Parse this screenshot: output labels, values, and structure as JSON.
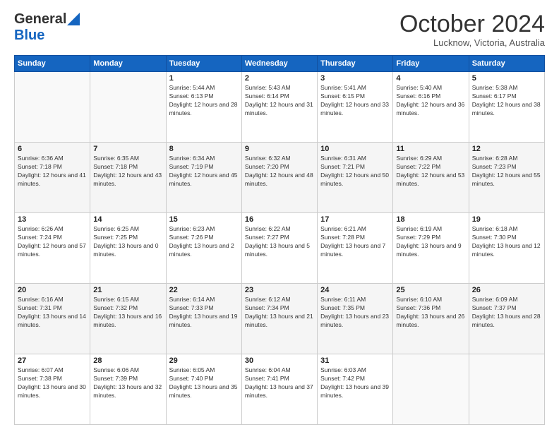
{
  "header": {
    "logo_general": "General",
    "logo_blue": "Blue",
    "month_title": "October 2024",
    "location": "Lucknow, Victoria, Australia"
  },
  "weekdays": [
    "Sunday",
    "Monday",
    "Tuesday",
    "Wednesday",
    "Thursday",
    "Friday",
    "Saturday"
  ],
  "weeks": [
    [
      {
        "day": "",
        "sunrise": "",
        "sunset": "",
        "daylight": ""
      },
      {
        "day": "",
        "sunrise": "",
        "sunset": "",
        "daylight": ""
      },
      {
        "day": "1",
        "sunrise": "Sunrise: 5:44 AM",
        "sunset": "Sunset: 6:13 PM",
        "daylight": "Daylight: 12 hours and 28 minutes."
      },
      {
        "day": "2",
        "sunrise": "Sunrise: 5:43 AM",
        "sunset": "Sunset: 6:14 PM",
        "daylight": "Daylight: 12 hours and 31 minutes."
      },
      {
        "day": "3",
        "sunrise": "Sunrise: 5:41 AM",
        "sunset": "Sunset: 6:15 PM",
        "daylight": "Daylight: 12 hours and 33 minutes."
      },
      {
        "day": "4",
        "sunrise": "Sunrise: 5:40 AM",
        "sunset": "Sunset: 6:16 PM",
        "daylight": "Daylight: 12 hours and 36 minutes."
      },
      {
        "day": "5",
        "sunrise": "Sunrise: 5:38 AM",
        "sunset": "Sunset: 6:17 PM",
        "daylight": "Daylight: 12 hours and 38 minutes."
      }
    ],
    [
      {
        "day": "6",
        "sunrise": "Sunrise: 6:36 AM",
        "sunset": "Sunset: 7:18 PM",
        "daylight": "Daylight: 12 hours and 41 minutes."
      },
      {
        "day": "7",
        "sunrise": "Sunrise: 6:35 AM",
        "sunset": "Sunset: 7:18 PM",
        "daylight": "Daylight: 12 hours and 43 minutes."
      },
      {
        "day": "8",
        "sunrise": "Sunrise: 6:34 AM",
        "sunset": "Sunset: 7:19 PM",
        "daylight": "Daylight: 12 hours and 45 minutes."
      },
      {
        "day": "9",
        "sunrise": "Sunrise: 6:32 AM",
        "sunset": "Sunset: 7:20 PM",
        "daylight": "Daylight: 12 hours and 48 minutes."
      },
      {
        "day": "10",
        "sunrise": "Sunrise: 6:31 AM",
        "sunset": "Sunset: 7:21 PM",
        "daylight": "Daylight: 12 hours and 50 minutes."
      },
      {
        "day": "11",
        "sunrise": "Sunrise: 6:29 AM",
        "sunset": "Sunset: 7:22 PM",
        "daylight": "Daylight: 12 hours and 53 minutes."
      },
      {
        "day": "12",
        "sunrise": "Sunrise: 6:28 AM",
        "sunset": "Sunset: 7:23 PM",
        "daylight": "Daylight: 12 hours and 55 minutes."
      }
    ],
    [
      {
        "day": "13",
        "sunrise": "Sunrise: 6:26 AM",
        "sunset": "Sunset: 7:24 PM",
        "daylight": "Daylight: 12 hours and 57 minutes."
      },
      {
        "day": "14",
        "sunrise": "Sunrise: 6:25 AM",
        "sunset": "Sunset: 7:25 PM",
        "daylight": "Daylight: 13 hours and 0 minutes."
      },
      {
        "day": "15",
        "sunrise": "Sunrise: 6:23 AM",
        "sunset": "Sunset: 7:26 PM",
        "daylight": "Daylight: 13 hours and 2 minutes."
      },
      {
        "day": "16",
        "sunrise": "Sunrise: 6:22 AM",
        "sunset": "Sunset: 7:27 PM",
        "daylight": "Daylight: 13 hours and 5 minutes."
      },
      {
        "day": "17",
        "sunrise": "Sunrise: 6:21 AM",
        "sunset": "Sunset: 7:28 PM",
        "daylight": "Daylight: 13 hours and 7 minutes."
      },
      {
        "day": "18",
        "sunrise": "Sunrise: 6:19 AM",
        "sunset": "Sunset: 7:29 PM",
        "daylight": "Daylight: 13 hours and 9 minutes."
      },
      {
        "day": "19",
        "sunrise": "Sunrise: 6:18 AM",
        "sunset": "Sunset: 7:30 PM",
        "daylight": "Daylight: 13 hours and 12 minutes."
      }
    ],
    [
      {
        "day": "20",
        "sunrise": "Sunrise: 6:16 AM",
        "sunset": "Sunset: 7:31 PM",
        "daylight": "Daylight: 13 hours and 14 minutes."
      },
      {
        "day": "21",
        "sunrise": "Sunrise: 6:15 AM",
        "sunset": "Sunset: 7:32 PM",
        "daylight": "Daylight: 13 hours and 16 minutes."
      },
      {
        "day": "22",
        "sunrise": "Sunrise: 6:14 AM",
        "sunset": "Sunset: 7:33 PM",
        "daylight": "Daylight: 13 hours and 19 minutes."
      },
      {
        "day": "23",
        "sunrise": "Sunrise: 6:12 AM",
        "sunset": "Sunset: 7:34 PM",
        "daylight": "Daylight: 13 hours and 21 minutes."
      },
      {
        "day": "24",
        "sunrise": "Sunrise: 6:11 AM",
        "sunset": "Sunset: 7:35 PM",
        "daylight": "Daylight: 13 hours and 23 minutes."
      },
      {
        "day": "25",
        "sunrise": "Sunrise: 6:10 AM",
        "sunset": "Sunset: 7:36 PM",
        "daylight": "Daylight: 13 hours and 26 minutes."
      },
      {
        "day": "26",
        "sunrise": "Sunrise: 6:09 AM",
        "sunset": "Sunset: 7:37 PM",
        "daylight": "Daylight: 13 hours and 28 minutes."
      }
    ],
    [
      {
        "day": "27",
        "sunrise": "Sunrise: 6:07 AM",
        "sunset": "Sunset: 7:38 PM",
        "daylight": "Daylight: 13 hours and 30 minutes."
      },
      {
        "day": "28",
        "sunrise": "Sunrise: 6:06 AM",
        "sunset": "Sunset: 7:39 PM",
        "daylight": "Daylight: 13 hours and 32 minutes."
      },
      {
        "day": "29",
        "sunrise": "Sunrise: 6:05 AM",
        "sunset": "Sunset: 7:40 PM",
        "daylight": "Daylight: 13 hours and 35 minutes."
      },
      {
        "day": "30",
        "sunrise": "Sunrise: 6:04 AM",
        "sunset": "Sunset: 7:41 PM",
        "daylight": "Daylight: 13 hours and 37 minutes."
      },
      {
        "day": "31",
        "sunrise": "Sunrise: 6:03 AM",
        "sunset": "Sunset: 7:42 PM",
        "daylight": "Daylight: 13 hours and 39 minutes."
      },
      {
        "day": "",
        "sunrise": "",
        "sunset": "",
        "daylight": ""
      },
      {
        "day": "",
        "sunrise": "",
        "sunset": "",
        "daylight": ""
      }
    ]
  ]
}
